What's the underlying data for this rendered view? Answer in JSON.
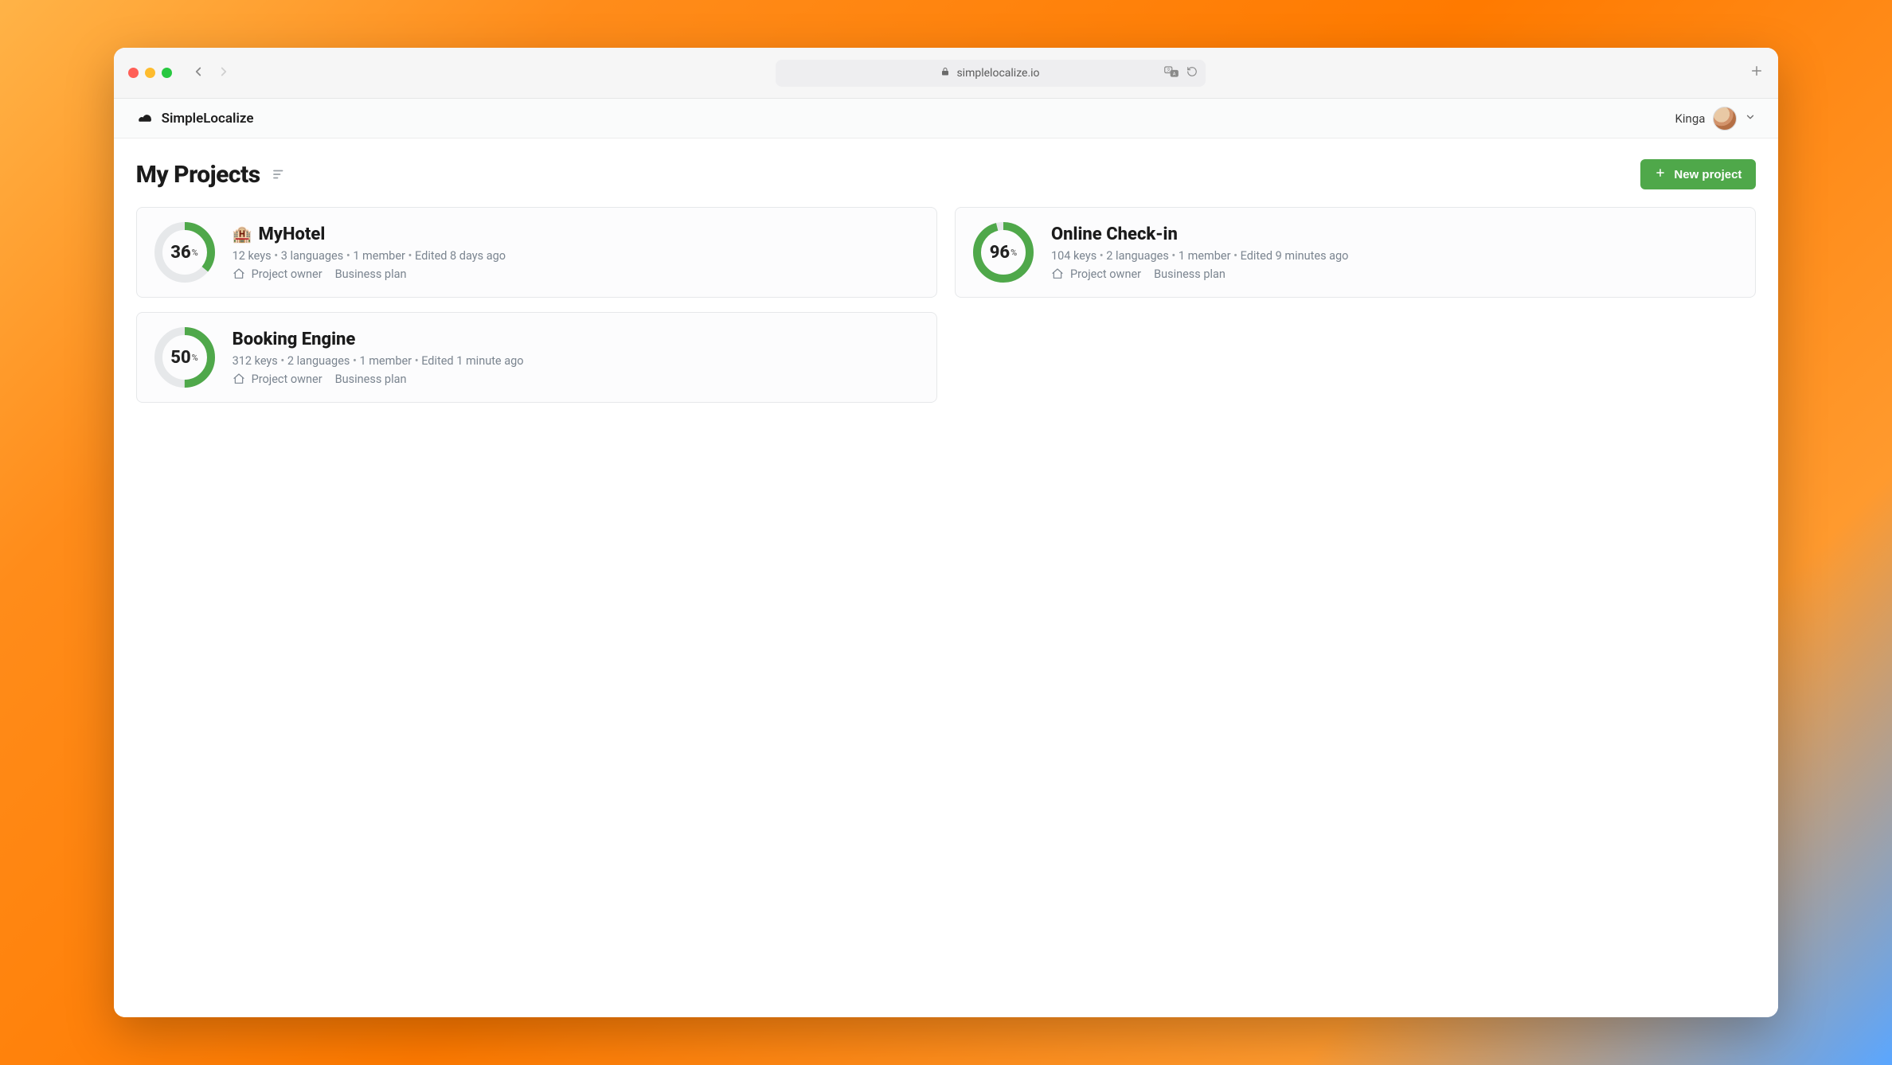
{
  "browser": {
    "address": "simplelocalize.io"
  },
  "header": {
    "brand": "SimpleLocalize",
    "user_name": "Kinga"
  },
  "page": {
    "title": "My Projects",
    "new_project_label": "New project"
  },
  "projects": [
    {
      "emoji": "🏨",
      "name": "MyHotel",
      "percent": 36,
      "keys": "12 keys",
      "languages": "3 languages",
      "members": "1 member",
      "edited": "Edited 8 days ago",
      "role": "Project owner",
      "plan": "Business plan"
    },
    {
      "emoji": "",
      "name": "Online Check-in",
      "percent": 96,
      "keys": "104 keys",
      "languages": "2 languages",
      "members": "1 member",
      "edited": "Edited 9 minutes ago",
      "role": "Project owner",
      "plan": "Business plan"
    },
    {
      "emoji": "",
      "name": "Booking Engine",
      "percent": 50,
      "keys": "312 keys",
      "languages": "2 languages",
      "members": "1 member",
      "edited": "Edited 1 minute ago",
      "role": "Project owner",
      "plan": "Business plan"
    }
  ],
  "colors": {
    "accent_green": "#4fa84a",
    "ring_track": "#e6e8ea"
  }
}
